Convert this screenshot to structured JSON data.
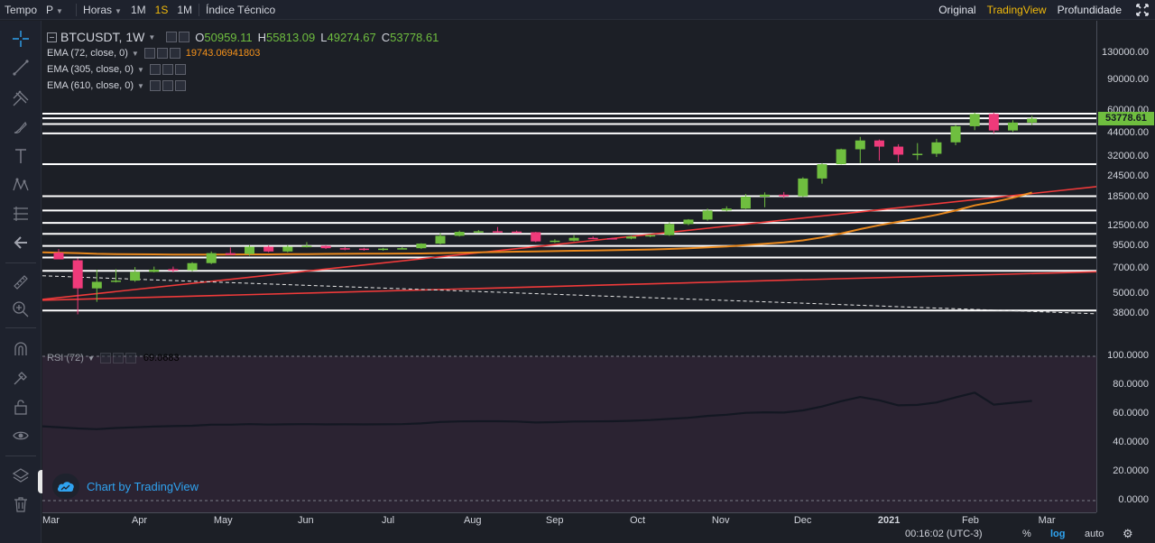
{
  "toolbar": {
    "time_label": "Tempo",
    "interval": "P",
    "hours_label": "Horas",
    "intervals": [
      "1M",
      "1S",
      "1M"
    ],
    "active_interval_index": 1,
    "indicators_label": "Índice Técnico"
  },
  "views": [
    "Original",
    "TradingView",
    "Profundidade"
  ],
  "active_view_index": 1,
  "symbol": {
    "name": "BTCUSDT, 1W",
    "open_k": "O",
    "open": "50959.11",
    "high_k": "H",
    "high": "55813.09",
    "low_k": "L",
    "low": "49274.67",
    "close_k": "C",
    "close": "53778.61"
  },
  "indicators": [
    {
      "label": "EMA (72, close, 0)",
      "value": "19743.06941803"
    },
    {
      "label": "EMA (305, close, 0)",
      "value": ""
    },
    {
      "label": "EMA (610, close, 0)",
      "value": ""
    }
  ],
  "rsi": {
    "label": "RSI (72)",
    "value": "69.0683"
  },
  "watermark": "Chart by TradingView",
  "price_axis": [
    "130000.00",
    "90000.00",
    "60000.00",
    "44000.00",
    "32000.00",
    "24500.00",
    "18500.00",
    "12500.00",
    "9500.00",
    "7000.00",
    "5000.00",
    "3800.00"
  ],
  "last_price": "53778.61",
  "rsi_axis": [
    "100.0000",
    "80.0000",
    "60.0000",
    "40.0000",
    "20.0000",
    "0.0000"
  ],
  "time_axis": [
    "Mar",
    "Apr",
    "May",
    "Jun",
    "Jul",
    "Aug",
    "Sep",
    "Oct",
    "Nov",
    "Dec",
    "2021",
    "Feb",
    "Mar"
  ],
  "bottom": {
    "clock": "00:16:02 (UTC-3)",
    "percent": "%",
    "log": "log",
    "auto": "auto"
  },
  "colors": {
    "up": "#6fbe3f",
    "down": "#ef3a7a",
    "ema_orange": "#e8881e",
    "trend_red": "#ef3a3a",
    "accent": "#f0b90b"
  },
  "chart_data": {
    "type": "candlestick",
    "symbol": "BTCUSDT",
    "interval": "1W",
    "y_scale": "log",
    "y_range": [
      3500,
      140000
    ],
    "candles": [
      {
        "o": 8750,
        "h": 9200,
        "l": 8000,
        "c": 8000
      },
      {
        "o": 7900,
        "h": 8100,
        "l": 3800,
        "c": 5400
      },
      {
        "o": 5400,
        "h": 6950,
        "l": 4500,
        "c": 5900
      },
      {
        "o": 5900,
        "h": 7000,
        "l": 5850,
        "c": 6000
      },
      {
        "o": 6000,
        "h": 7200,
        "l": 5900,
        "c": 6750
      },
      {
        "o": 6750,
        "h": 7250,
        "l": 6700,
        "c": 6950
      },
      {
        "o": 7000,
        "h": 7250,
        "l": 6700,
        "c": 6900
      },
      {
        "o": 6900,
        "h": 7700,
        "l": 6800,
        "c": 7600
      },
      {
        "o": 7600,
        "h": 8900,
        "l": 7500,
        "c": 8700
      },
      {
        "o": 8700,
        "h": 9400,
        "l": 8500,
        "c": 8500
      },
      {
        "o": 8600,
        "h": 9700,
        "l": 8400,
        "c": 9500
      },
      {
        "o": 9500,
        "h": 9650,
        "l": 8800,
        "c": 8900
      },
      {
        "o": 8900,
        "h": 9700,
        "l": 8800,
        "c": 9500
      },
      {
        "o": 9500,
        "h": 10100,
        "l": 9400,
        "c": 9600
      },
      {
        "o": 9600,
        "h": 9650,
        "l": 9200,
        "c": 9300
      },
      {
        "o": 9300,
        "h": 9450,
        "l": 9050,
        "c": 9250
      },
      {
        "o": 9250,
        "h": 9350,
        "l": 9000,
        "c": 9100
      },
      {
        "o": 9100,
        "h": 9350,
        "l": 9000,
        "c": 9250
      },
      {
        "o": 9250,
        "h": 9450,
        "l": 9150,
        "c": 9300
      },
      {
        "o": 9300,
        "h": 9950,
        "l": 9200,
        "c": 9900
      },
      {
        "o": 9900,
        "h": 11400,
        "l": 9800,
        "c": 11000
      },
      {
        "o": 11000,
        "h": 11800,
        "l": 10900,
        "c": 11600
      },
      {
        "o": 11600,
        "h": 11900,
        "l": 11400,
        "c": 11700
      },
      {
        "o": 11700,
        "h": 12400,
        "l": 11500,
        "c": 11650
      },
      {
        "o": 11650,
        "h": 11800,
        "l": 11400,
        "c": 11550
      },
      {
        "o": 11550,
        "h": 11600,
        "l": 10100,
        "c": 10200
      },
      {
        "o": 10200,
        "h": 10500,
        "l": 10000,
        "c": 10300
      },
      {
        "o": 10300,
        "h": 11100,
        "l": 10200,
        "c": 10700
      },
      {
        "o": 10700,
        "h": 10900,
        "l": 10600,
        "c": 10650
      },
      {
        "o": 10650,
        "h": 10700,
        "l": 10550,
        "c": 10600
      },
      {
        "o": 10600,
        "h": 11000,
        "l": 10500,
        "c": 10900
      },
      {
        "o": 10900,
        "h": 11200,
        "l": 10800,
        "c": 11100
      },
      {
        "o": 11100,
        "h": 13200,
        "l": 11000,
        "c": 12900
      },
      {
        "o": 12900,
        "h": 13800,
        "l": 12700,
        "c": 13700
      },
      {
        "o": 13700,
        "h": 15900,
        "l": 13500,
        "c": 15500
      },
      {
        "o": 15500,
        "h": 16400,
        "l": 15300,
        "c": 15900
      },
      {
        "o": 15900,
        "h": 19400,
        "l": 15800,
        "c": 18700
      },
      {
        "o": 18700,
        "h": 19800,
        "l": 16200,
        "c": 19200
      },
      {
        "o": 19200,
        "h": 19900,
        "l": 18300,
        "c": 18800
      },
      {
        "o": 18800,
        "h": 24300,
        "l": 18600,
        "c": 23900
      },
      {
        "o": 23900,
        "h": 29400,
        "l": 22300,
        "c": 29000
      },
      {
        "o": 29000,
        "h": 35800,
        "l": 28900,
        "c": 35500
      },
      {
        "o": 35500,
        "h": 42000,
        "l": 29500,
        "c": 40000
      },
      {
        "o": 40000,
        "h": 40500,
        "l": 30500,
        "c": 36800
      },
      {
        "o": 36800,
        "h": 38000,
        "l": 29800,
        "c": 33000
      },
      {
        "o": 33000,
        "h": 38600,
        "l": 30700,
        "c": 33400
      },
      {
        "o": 33400,
        "h": 40900,
        "l": 32000,
        "c": 39000
      },
      {
        "o": 39000,
        "h": 49500,
        "l": 37500,
        "c": 48500
      },
      {
        "o": 48500,
        "h": 58300,
        "l": 46000,
        "c": 57300
      },
      {
        "o": 57300,
        "h": 58400,
        "l": 44000,
        "c": 45800
      },
      {
        "o": 45800,
        "h": 52600,
        "l": 45000,
        "c": 51000
      },
      {
        "o": 50959.11,
        "h": 55813.09,
        "l": 49274.67,
        "c": 53778.61
      }
    ],
    "ema_72": [
      8800,
      8700,
      8620,
      8590,
      8570,
      8555,
      8540,
      8535,
      8540,
      8545,
      8555,
      8560,
      8575,
      8590,
      8605,
      8620,
      8630,
      8640,
      8650,
      8665,
      8700,
      8740,
      8785,
      8830,
      8875,
      8910,
      8945,
      8985,
      9020,
      9055,
      9095,
      9140,
      9205,
      9290,
      9400,
      9520,
      9690,
      9870,
      10050,
      10340,
      10770,
      11350,
      12050,
      12700,
      13300,
      13900,
      14600,
      15500,
      16600,
      17400,
      18400,
      19743.07
    ],
    "trend_lines": [
      {
        "from": [
          0,
          4650
        ],
        "to": [
          51,
          19500
        ]
      },
      {
        "from": [
          0,
          4600
        ],
        "to": [
          51,
          6600
        ]
      }
    ],
    "dashed_line": {
      "from": [
        0,
        6400
      ],
      "to": [
        51,
        3950
      ]
    },
    "horizontal_levels": [
      4000,
      6850,
      8200,
      9600,
      11300,
      13100,
      15500,
      18800,
      29000,
      44000,
      50000,
      54000,
      57500
    ],
    "rsi": [
      51.5,
      50,
      49.5,
      50.3,
      50.8,
      51.3,
      51.6,
      51.9,
      52.6,
      52.6,
      53,
      52.7,
      52.9,
      53,
      52.8,
      52.9,
      52.8,
      52.9,
      53,
      53.5,
      54.5,
      54.9,
      55,
      55,
      54.8,
      54.1,
      54.4,
      54.8,
      54.9,
      55,
      55.3,
      55.8,
      56.6,
      57.4,
      58.7,
      59.5,
      60.8,
      61.2,
      61,
      62.5,
      65.2,
      68.9,
      71.8,
      69.5,
      66,
      66.3,
      68,
      71.5,
      74.8,
      66.5,
      67.8,
      69.07
    ],
    "rsi_range": [
      0,
      100
    ],
    "x_labels": [
      "Mar",
      "Apr",
      "May",
      "Jun",
      "Jul",
      "Aug",
      "Sep",
      "Oct",
      "Nov",
      "Dec",
      "2021",
      "Feb",
      "Mar"
    ]
  }
}
